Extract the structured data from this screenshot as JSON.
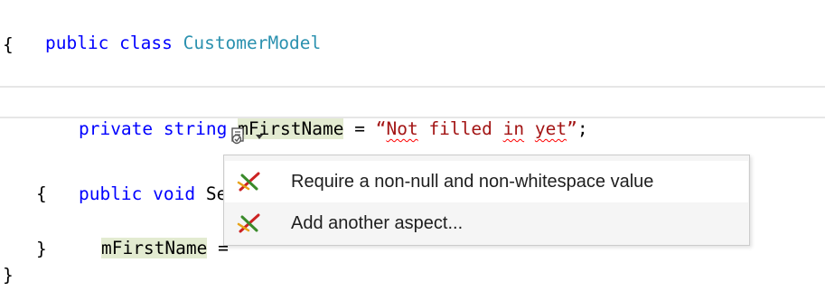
{
  "code": {
    "line1": {
      "kw": "public class ",
      "class_name": "CustomerModel"
    },
    "line2": "{",
    "line4": {
      "kw": "private string ",
      "field": "mFirstName",
      "mid": " = ",
      "str_q1": "“",
      "str_w1": "Not",
      "str_s1": " filled ",
      "str_w2": "in",
      "str_s2": " ",
      "str_w3": "yet",
      "str_q2": "”",
      "end": ";"
    },
    "line6": {
      "kw": "public void ",
      "rest": "Set"
    },
    "line7": "{",
    "line8": {
      "field": "mFirstName",
      "rest": " ="
    },
    "line9": "}",
    "line10": "}"
  },
  "smart_tag": {
    "icon": "smart-tag-icon"
  },
  "menu": {
    "items": [
      {
        "label": "Require a non-null and non-whitespace value",
        "icon": "aspect-icon"
      },
      {
        "label": "Add another aspect...",
        "icon": "aspect-icon"
      }
    ]
  },
  "colors": {
    "keyword": "#0000ff",
    "type": "#2b91af",
    "string": "#a31515",
    "highlight": "#e3ebd1"
  }
}
